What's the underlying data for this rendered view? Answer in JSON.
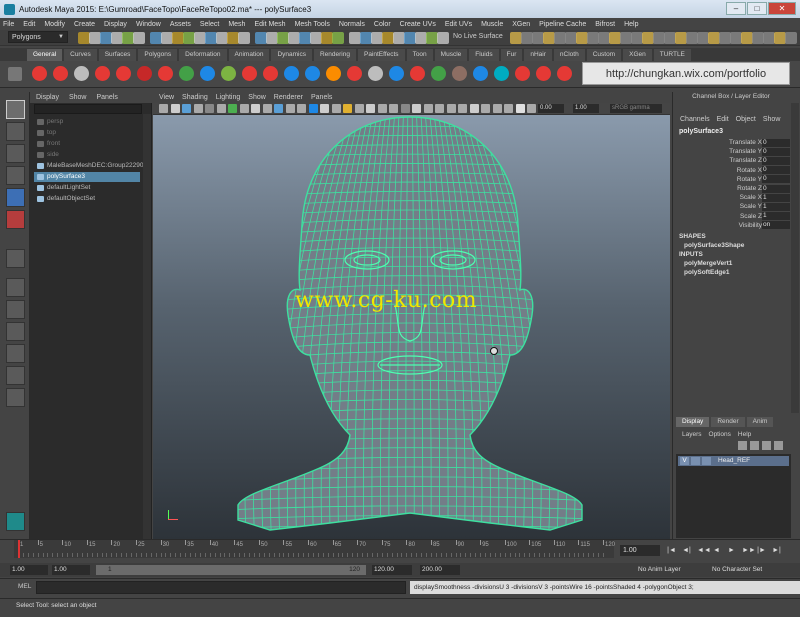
{
  "window": {
    "title": "Autodesk Maya 2015: E:\\Gumroad\\FaceTopo\\FaceReTopo02.ma*   ---   polySurface3"
  },
  "menubar": [
    "File",
    "Edit",
    "Modify",
    "Create",
    "Display",
    "Window",
    "Assets",
    "Select",
    "Mesh",
    "Edit Mesh",
    "Mesh Tools",
    "Normals",
    "Color",
    "Create UVs",
    "Edit UVs",
    "Muscle",
    "XGen",
    "Pipeline Cache",
    "Bifrost",
    "Help"
  ],
  "status": {
    "mode": "Polygons",
    "live_surface": "No Live Surface"
  },
  "shelf": {
    "tabs": [
      "General",
      "Curves",
      "Surfaces",
      "Polygons",
      "Deformation",
      "Animation",
      "Dynamics",
      "Rendering",
      "PaintEffects",
      "Toon",
      "Muscle",
      "Fluids",
      "Fur",
      "nHair",
      "nCloth",
      "Custom",
      "XGen",
      "TURTLE"
    ],
    "active_tab": "General",
    "url": "http://chungkan.wix.com/portfolio"
  },
  "outliner": {
    "menu": [
      "Display",
      "Show",
      "Panels"
    ],
    "items": [
      {
        "label": "persp",
        "state": "dim"
      },
      {
        "label": "top",
        "state": "dim"
      },
      {
        "label": "front",
        "state": "dim"
      },
      {
        "label": "side",
        "state": "dim"
      },
      {
        "label": "MaleBaseMeshDEC:Group22290",
        "state": "normal"
      },
      {
        "label": "polySurface3",
        "state": "selected"
      },
      {
        "label": "defaultLightSet",
        "state": "normal"
      },
      {
        "label": "defaultObjectSet",
        "state": "normal"
      }
    ]
  },
  "viewport": {
    "menu": [
      "View",
      "Shading",
      "Lighting",
      "Show",
      "Renderer",
      "Panels"
    ],
    "field_a": "0.00",
    "field_b": "1.00",
    "gamma": "sRGB gamma",
    "watermark": "www.cg-ku.com"
  },
  "channel_box": {
    "title": "Channel Box / Layer Editor",
    "menu": [
      "Channels",
      "Edit",
      "Object",
      "Show"
    ],
    "object": "polySurface3",
    "attributes": [
      {
        "name": "Translate X",
        "value": "0"
      },
      {
        "name": "Translate Y",
        "value": "0"
      },
      {
        "name": "Translate Z",
        "value": "0"
      },
      {
        "name": "Rotate X",
        "value": "0"
      },
      {
        "name": "Rotate Y",
        "value": "0"
      },
      {
        "name": "Rotate Z",
        "value": "0"
      },
      {
        "name": "Scale X",
        "value": "1"
      },
      {
        "name": "Scale Y",
        "value": "1"
      },
      {
        "name": "Scale Z",
        "value": "1"
      },
      {
        "name": "Visibility",
        "value": "on"
      }
    ],
    "shapes_header": "SHAPES",
    "shapes": [
      "polySurface3Shape"
    ],
    "inputs_header": "INPUTS",
    "inputs": [
      "polyMergeVert1",
      "polySoftEdge1"
    ]
  },
  "layer_editor": {
    "tabs": [
      "Display",
      "Render",
      "Anim"
    ],
    "active_tab": "Display",
    "menu": [
      "Layers",
      "Options",
      "Help"
    ],
    "layers": [
      {
        "flag": "V",
        "name": "Head_REF"
      }
    ]
  },
  "timeline": {
    "ticks": [
      "1",
      "5",
      "10",
      "15",
      "20",
      "25",
      "30",
      "35",
      "40",
      "45",
      "50",
      "55",
      "60",
      "65",
      "70",
      "75",
      "80",
      "85",
      "90",
      "95",
      "100",
      "105",
      "110",
      "115",
      "120"
    ],
    "current_frame": "1.00",
    "playback": [
      "|◄",
      "◄|",
      "◄◄",
      "◄",
      "►",
      "►►",
      "|►",
      "►|"
    ]
  },
  "range": {
    "start": "1.00",
    "playback_start": "1.00",
    "slider_start": "1",
    "slider_end": "120",
    "playback_end": "120.00",
    "end": "200.00",
    "anim_layer": "No Anim Layer",
    "character_set": "No Character Set"
  },
  "command": {
    "label": "MEL",
    "result": "displaySmoothness -divisionsU 3 -divisionsV 3 -pointsWire 16 -pointsShaded 4 -polygonObject 3;"
  },
  "help_line": "Select Tool: select an object",
  "colors": {
    "wireframe": "#3ee0a0",
    "selection": "#5285a6",
    "watermark": "#f0e800"
  }
}
